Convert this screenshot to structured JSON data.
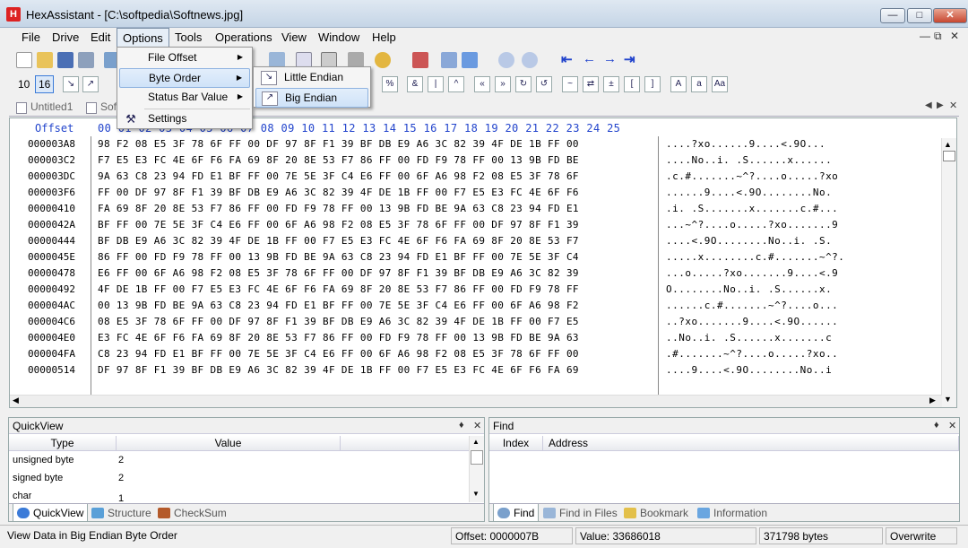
{
  "window": {
    "title": "HexAssistant - [C:\\softpedia\\Softnews.jpg]"
  },
  "menu": {
    "file": "File",
    "drive": "Drive",
    "edit": "Edit",
    "options": "Options",
    "tools": "Tools",
    "operations": "Operations",
    "view": "View",
    "window": "Window",
    "help": "Help"
  },
  "toolbar2": {
    "base10": "10",
    "base16": "16"
  },
  "doc_tabs": {
    "tab1": "Untitled1",
    "tab2": "Sof"
  },
  "hex_view": {
    "header_offset": "Offset",
    "column_headers": "00 01 02 03 04 05 06 07 08 09 10 11 12 13 14 15 16 17 18 19 20 21 22 23 24 25",
    "rows": [
      {
        "offset": "000003A8",
        "bytes": "98 F2 08 E5 3F 78 6F FF 00 DF 97 8F F1 39 BF DB E9 A6 3C 82 39 4F DE 1B FF 00",
        "ascii": "....?xo......9....<.9O..."
      },
      {
        "offset": "000003C2",
        "bytes": "F7 E5 E3 FC 4E 6F F6 FA 69 8F 20 8E 53 F7 86 FF 00 FD F9 78 FF 00 13 9B FD BE",
        "ascii": "....No..i. .S......x......"
      },
      {
        "offset": "000003DC",
        "bytes": "9A 63 C8 23 94 FD E1 BF FF 00 7E 5E 3F C4 E6 FF 00 6F A6 98 F2 08 E5 3F 78 6F",
        "ascii": ".c.#.......~^?....o.....?xo"
      },
      {
        "offset": "000003F6",
        "bytes": "FF 00 DF 97 8F F1 39 BF DB E9 A6 3C 82 39 4F DE 1B FF 00 F7 E5 E3 FC 4E 6F F6",
        "ascii": "......9....<.9O........No."
      },
      {
        "offset": "00000410",
        "bytes": "FA 69 8F 20 8E 53 F7 86 FF 00 FD F9 78 FF 00 13 9B FD BE 9A 63 C8 23 94 FD E1",
        "ascii": ".i. .S.......x.......c.#..."
      },
      {
        "offset": "0000042A",
        "bytes": "BF FF 00 7E 5E 3F C4 E6 FF 00 6F A6 98 F2 08 E5 3F 78 6F FF 00 DF 97 8F F1 39",
        "ascii": "...~^?....o.....?xo.......9"
      },
      {
        "offset": "00000444",
        "bytes": "BF DB E9 A6 3C 82 39 4F DE 1B FF 00 F7 E5 E3 FC 4E 6F F6 FA 69 8F 20 8E 53 F7",
        "ascii": "....<.9O........No..i. .S."
      },
      {
        "offset": "0000045E",
        "bytes": "86 FF 00 FD F9 78 FF 00 13 9B FD BE 9A 63 C8 23 94 FD E1 BF FF 00 7E 5E 3F C4",
        "ascii": ".....x........c.#.......~^?."
      },
      {
        "offset": "00000478",
        "bytes": "E6 FF 00 6F A6 98 F2 08 E5 3F 78 6F FF 00 DF 97 8F F1 39 BF DB E9 A6 3C 82 39",
        "ascii": "...o.....?xo.......9....<.9"
      },
      {
        "offset": "00000492",
        "bytes": "4F DE 1B FF 00 F7 E5 E3 FC 4E 6F F6 FA 69 8F 20 8E 53 F7 86 FF 00 FD F9 78 FF",
        "ascii": "O........No..i. .S......x."
      },
      {
        "offset": "000004AC",
        "bytes": "00 13 9B FD BE 9A 63 C8 23 94 FD E1 BF FF 00 7E 5E 3F C4 E6 FF 00 6F A6 98 F2",
        "ascii": "......c.#.......~^?....o..."
      },
      {
        "offset": "000004C6",
        "bytes": "08 E5 3F 78 6F FF 00 DF 97 8F F1 39 BF DB E9 A6 3C 82 39 4F DE 1B FF 00 F7 E5",
        "ascii": "..?xo.......9....<.9O......"
      },
      {
        "offset": "000004E0",
        "bytes": "E3 FC 4E 6F F6 FA 69 8F 20 8E 53 F7 86 FF 00 FD F9 78 FF 00 13 9B FD BE 9A 63",
        "ascii": "..No..i. .S......x.......c"
      },
      {
        "offset": "000004FA",
        "bytes": "C8 23 94 FD E1 BF FF 00 7E 5E 3F C4 E6 FF 00 6F A6 98 F2 08 E5 3F 78 6F FF 00",
        "ascii": ".#.......~^?....o.....?xo.."
      },
      {
        "offset": "00000514",
        "bytes": "DF 97 8F F1 39 BF DB E9 A6 3C 82 39 4F DE 1B FF 00 F7 E5 E3 FC 4E 6F F6 FA 69",
        "ascii": "....9....<.9O........No..i"
      }
    ]
  },
  "quickview": {
    "title": "QuickView",
    "col_type": "Type",
    "col_value": "Value",
    "rows": [
      {
        "type": "unsigned byte",
        "value": "2"
      },
      {
        "type": "signed byte",
        "value": "2"
      },
      {
        "type": "char",
        "value": "1"
      }
    ],
    "tabs": {
      "quickview": "QuickView",
      "structure": "Structure",
      "checksum": "CheckSum"
    }
  },
  "find": {
    "title": "Find",
    "col_index": "Index",
    "col_address": "Address",
    "tabs": {
      "find": "Find",
      "find_in_files": "Find in Files",
      "bookmark": "Bookmark",
      "information": "Information"
    }
  },
  "options_menu": {
    "file_offset": "File Offset",
    "byte_order": "Byte Order",
    "status_bar_value": "Status Bar Value",
    "settings": "Settings"
  },
  "byte_order_menu": {
    "little_endian": "Little Endian",
    "big_endian": "Big Endian"
  },
  "status_bar": {
    "message": "View Data in Big Endian Byte Order",
    "offset": "Offset: 0000007B",
    "value": "Value: 33686018",
    "size": "371798 bytes",
    "mode": "Overwrite"
  }
}
